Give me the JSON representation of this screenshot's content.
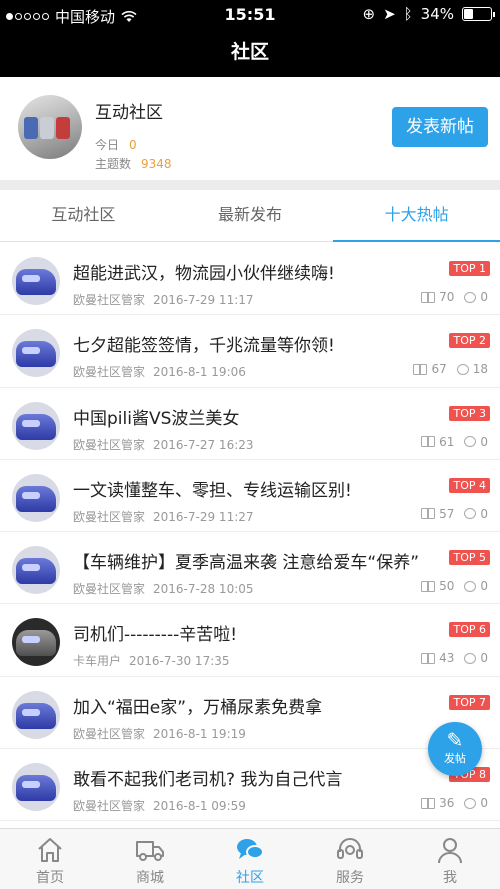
{
  "status_bar": {
    "carrier": "中国移动",
    "time": "15:51",
    "battery": "34%",
    "battery_level": 0.34
  },
  "nav": {
    "title": "社区"
  },
  "community": {
    "name": "互动社区",
    "today_label": "今日",
    "today_value": "0",
    "topics_label": "主题数",
    "topics_value": "9348",
    "post_button": "发表新帖"
  },
  "tabs": [
    {
      "label": "互动社区",
      "active": false
    },
    {
      "label": "最新发布",
      "active": false
    },
    {
      "label": "十大热帖",
      "active": true
    }
  ],
  "posts": [
    {
      "title": "超能进武汉，物流园小伙伴继续嗨!",
      "author": "欧曼社区管家",
      "date": "2016-7-29 11:17",
      "badge": "TOP 1",
      "views": "70",
      "comments": "0",
      "avatar": "truck-avatar"
    },
    {
      "title": "七夕超能签签情，千兆流量等你领!",
      "author": "欧曼社区管家",
      "date": "2016-8-1 19:06",
      "badge": "TOP 2",
      "views": "67",
      "comments": "18",
      "avatar": "truck-avatar"
    },
    {
      "title": "中国pili酱VS波兰美女",
      "author": "欧曼社区管家",
      "date": "2016-7-27 16:23",
      "badge": "TOP 3",
      "views": "61",
      "comments": "0",
      "avatar": "truck-avatar"
    },
    {
      "title": "一文读懂整车、零担、专线运输区别!",
      "author": "欧曼社区管家",
      "date": "2016-7-29 11:27",
      "badge": "TOP 4",
      "views": "57",
      "comments": "0",
      "avatar": "truck-avatar"
    },
    {
      "title": "【车辆维护】夏季高温来袭 注意给爱车“保养”",
      "author": "欧曼社区管家",
      "date": "2016-7-28 10:05",
      "badge": "TOP 5",
      "views": "50",
      "comments": "0",
      "avatar": "truck-avatar"
    },
    {
      "title": "司机们---------辛苦啦!",
      "author": "卡车用户",
      "date": "2016-7-30 17:35",
      "badge": "TOP 6",
      "views": "43",
      "comments": "0",
      "avatar": "robot-avatar"
    },
    {
      "title": "加入“福田e家”，万桶尿素免费拿",
      "author": "欧曼社区管家",
      "date": "2016-8-1 19:19",
      "badge": "TOP 7",
      "views": "",
      "comments": "",
      "avatar": "truck-avatar"
    },
    {
      "title": "敢看不起我们老司机? 我为自己代言",
      "author": "欧曼社区管家",
      "date": "2016-8-1 09:59",
      "badge": "TOP 8",
      "views": "36",
      "comments": "0",
      "avatar": "truck-avatar"
    }
  ],
  "fab": {
    "label": "发帖",
    "icon": "pen-icon"
  },
  "tab_bar": [
    {
      "label": "首页",
      "icon": "home-icon",
      "active": false
    },
    {
      "label": "商城",
      "icon": "truck-icon",
      "active": false
    },
    {
      "label": "社区",
      "icon": "chat-icon",
      "active": true
    },
    {
      "label": "服务",
      "icon": "headset-icon",
      "active": false
    },
    {
      "label": "我",
      "icon": "user-icon",
      "active": false
    }
  ],
  "colors": {
    "accent": "#2ea2e8",
    "badge": "#ef5350",
    "count": "#e8a13a"
  }
}
